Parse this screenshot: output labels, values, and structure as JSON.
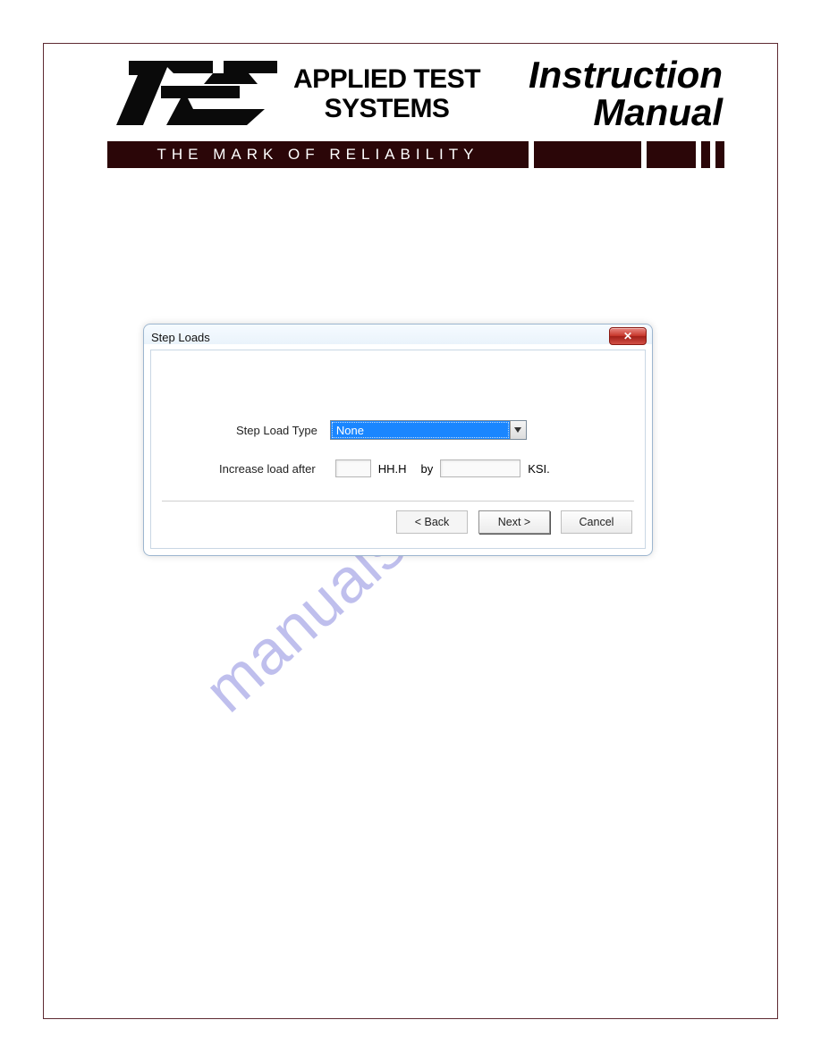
{
  "header": {
    "company_line1": "APPLIED TEST",
    "company_line2": "SYSTEMS",
    "title_line1": "Instruction",
    "title_line2": "Manual",
    "tagline": "THE MARK OF RELIABILITY"
  },
  "dialog": {
    "title": "Step Loads",
    "close": "✕",
    "step_load_type_label": "Step Load Type",
    "step_load_type_value": "None",
    "increase_load_after_label": "Increase load after",
    "time_unit": "HH.H",
    "by_label": "by",
    "load_unit": "KSI.",
    "back_label": "< Back",
    "next_label": "Next >",
    "cancel_label": "Cancel"
  },
  "watermark": "manualshive.com"
}
